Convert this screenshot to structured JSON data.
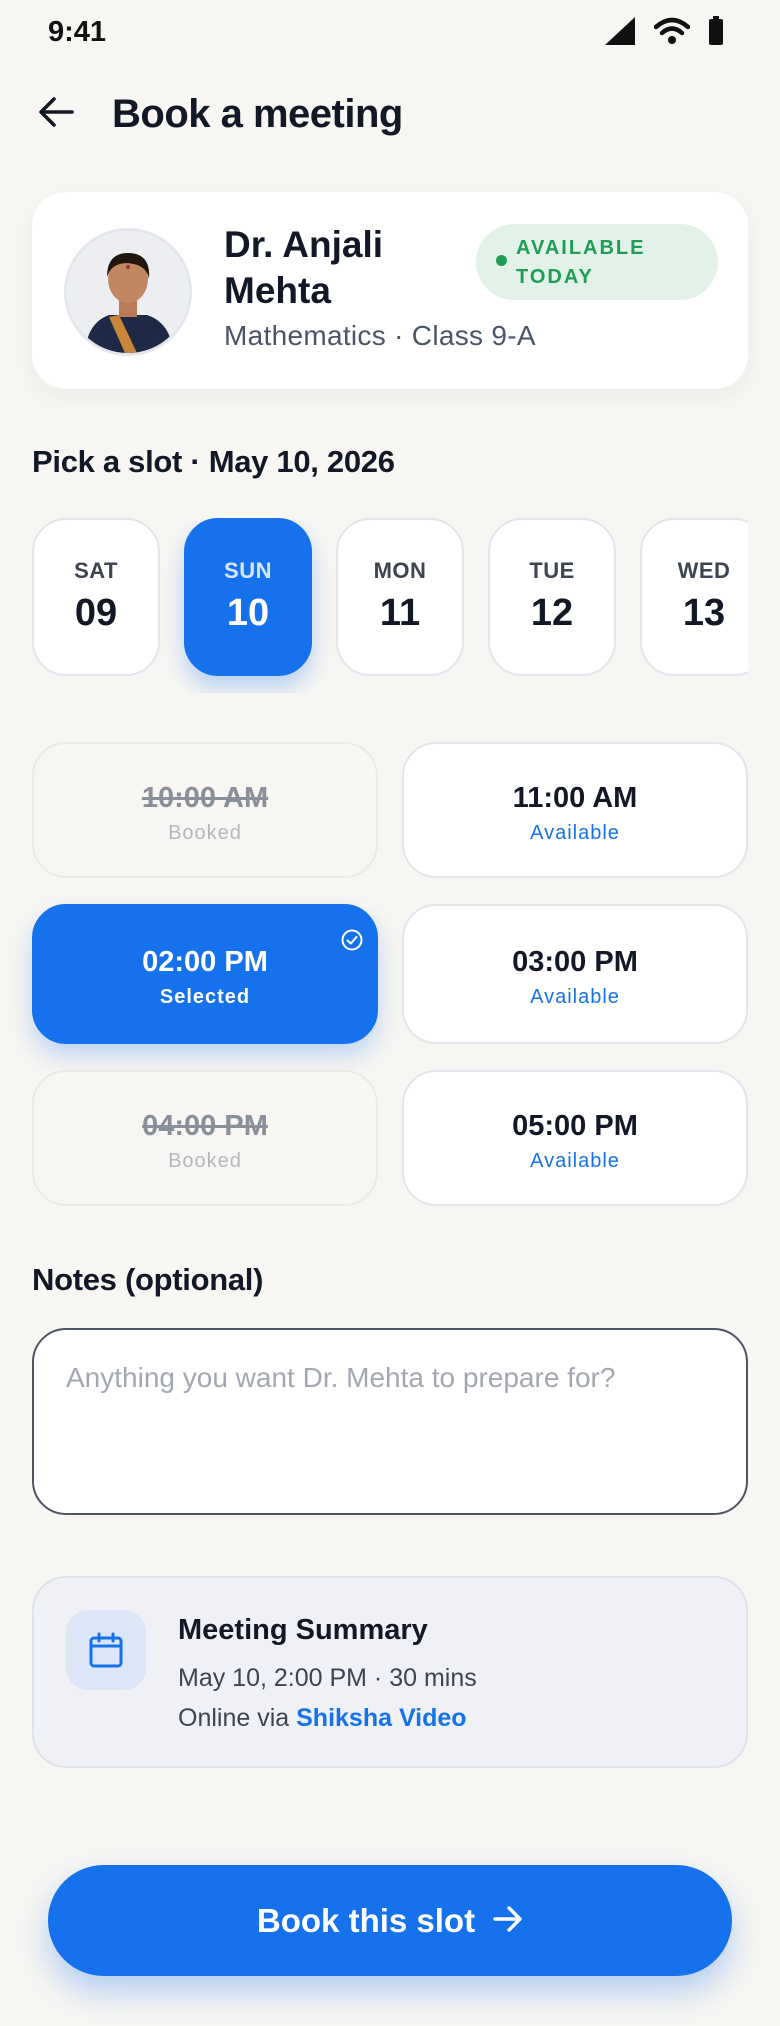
{
  "status_bar": {
    "time": "9:41",
    "icons": [
      "cellular-signal-icon",
      "wifi-icon",
      "battery-icon"
    ]
  },
  "header": {
    "title": "Book a meeting",
    "back_icon": "arrow-left-icon"
  },
  "teacher": {
    "name": "Dr. Anjali Mehta",
    "subtitle": "Mathematics · Class 9-A",
    "availability": "AVAILABLE TODAY",
    "availability_color": "#1f9d55"
  },
  "slot_picker": {
    "title": "Pick a slot · May 10, 2026",
    "dates": [
      {
        "dow": "SAT",
        "day": "09",
        "selected": false
      },
      {
        "dow": "SUN",
        "day": "10",
        "selected": true
      },
      {
        "dow": "MON",
        "day": "11",
        "selected": false
      },
      {
        "dow": "TUE",
        "day": "12",
        "selected": false
      },
      {
        "dow": "WED",
        "day": "13",
        "selected": false
      }
    ],
    "times": [
      {
        "time": "10:00 AM",
        "status": "Booked"
      },
      {
        "time": "11:00 AM",
        "status": "Available"
      },
      {
        "time": "02:00 PM",
        "status": "Selected"
      },
      {
        "time": "03:00 PM",
        "status": "Available"
      },
      {
        "time": "04:00 PM",
        "status": "Booked"
      },
      {
        "time": "05:00 PM",
        "status": "Available"
      }
    ]
  },
  "notes": {
    "label": "Notes (optional)",
    "placeholder": "Anything you want Dr. Mehta to prepare for?",
    "value": ""
  },
  "summary": {
    "title": "Meeting Summary",
    "when": "May 10, 2:00 PM · 30 mins",
    "via_prefix": "Online via",
    "via_platform": "Shiksha Video",
    "icon": "calendar-icon"
  },
  "cta": {
    "label": "Book this slot",
    "icon": "arrow-right-icon"
  },
  "colors": {
    "accent": "#1672ec",
    "background": "#f7f6f3",
    "success": "#1f9d55"
  }
}
